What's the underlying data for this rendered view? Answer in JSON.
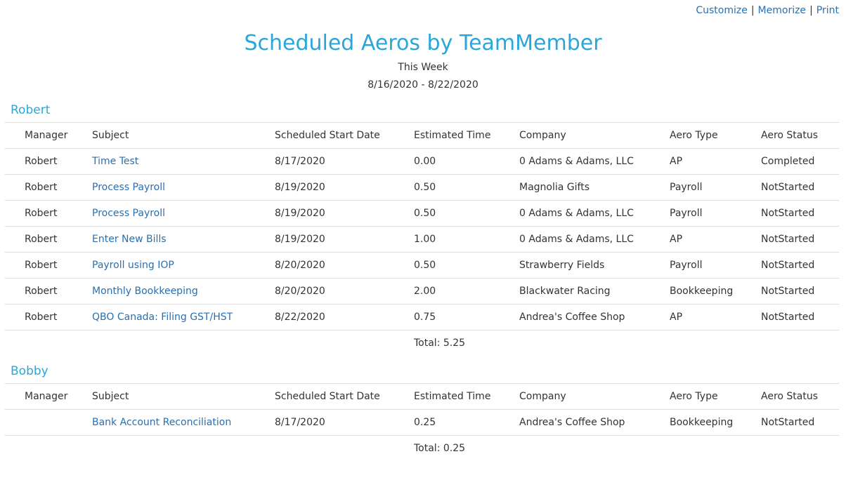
{
  "links": {
    "customize": "Customize",
    "memorize": "Memorize",
    "print": "Print",
    "separator": "|"
  },
  "header": {
    "title": "Scheduled Aeros by TeamMember",
    "period": "This Week",
    "date_range": "8/16/2020 - 8/22/2020"
  },
  "columns": [
    "Manager",
    "Subject",
    "Scheduled Start Date",
    "Estimated Time",
    "Company",
    "Aero Type",
    "Aero Status"
  ],
  "groups": [
    {
      "name": "Robert",
      "rows": [
        {
          "manager": "Robert",
          "subject": "Time Test",
          "start": "8/17/2020",
          "time": "0.00",
          "company": "0 Adams & Adams, LLC",
          "type": "AP",
          "status": "Completed"
        },
        {
          "manager": "Robert",
          "subject": "Process Payroll",
          "start": "8/19/2020",
          "time": "0.50",
          "company": "Magnolia Gifts",
          "type": "Payroll",
          "status": "NotStarted"
        },
        {
          "manager": "Robert",
          "subject": "Process Payroll",
          "start": "8/19/2020",
          "time": "0.50",
          "company": "0 Adams & Adams, LLC",
          "type": "Payroll",
          "status": "NotStarted"
        },
        {
          "manager": "Robert",
          "subject": "Enter New Bills",
          "start": "8/19/2020",
          "time": "1.00",
          "company": "0 Adams & Adams, LLC",
          "type": "AP",
          "status": "NotStarted"
        },
        {
          "manager": "Robert",
          "subject": "Payroll using IOP",
          "start": "8/20/2020",
          "time": "0.50",
          "company": "Strawberry Fields",
          "type": "Payroll",
          "status": "NotStarted"
        },
        {
          "manager": "Robert",
          "subject": "Monthly Bookkeeping",
          "start": "8/20/2020",
          "time": "2.00",
          "company": "Blackwater Racing",
          "type": "Bookkeeping",
          "status": "NotStarted"
        },
        {
          "manager": "Robert",
          "subject": "QBO Canada: Filing GST/HST",
          "start": "8/22/2020",
          "time": "0.75",
          "company": "Andrea's Coffee Shop",
          "type": "AP",
          "status": "NotStarted"
        }
      ],
      "total": "Total: 5.25"
    },
    {
      "name": "Bobby",
      "rows": [
        {
          "manager": "",
          "subject": "Bank Account Reconciliation",
          "start": "8/17/2020",
          "time": "0.25",
          "company": "Andrea's Coffee Shop",
          "type": "Bookkeeping",
          "status": "NotStarted"
        }
      ],
      "total": "Total: 0.25"
    }
  ]
}
